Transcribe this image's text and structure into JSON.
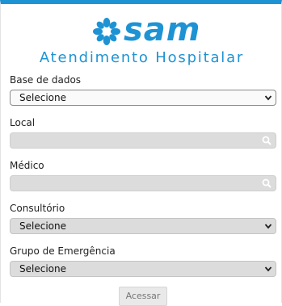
{
  "brand": {
    "logo_text": "sam",
    "subtitle": "Atendimento Hospitalar",
    "color": "#1e93d3"
  },
  "form": {
    "base_de_dados": {
      "label": "Base de dados",
      "value": "Selecione",
      "icon": "chevron-down-icon"
    },
    "local": {
      "label": "Local",
      "value": "",
      "icon": "search-icon"
    },
    "medico": {
      "label": "Médico",
      "value": "",
      "icon": "search-icon"
    },
    "consultorio": {
      "label": "Consultório",
      "value": "Selecione",
      "icon": "chevron-down-icon"
    },
    "grupo_emergencia": {
      "label": "Grupo de Emergência",
      "value": "Selecione",
      "icon": "chevron-down-icon"
    }
  },
  "actions": {
    "submit_label": "Acessar"
  }
}
